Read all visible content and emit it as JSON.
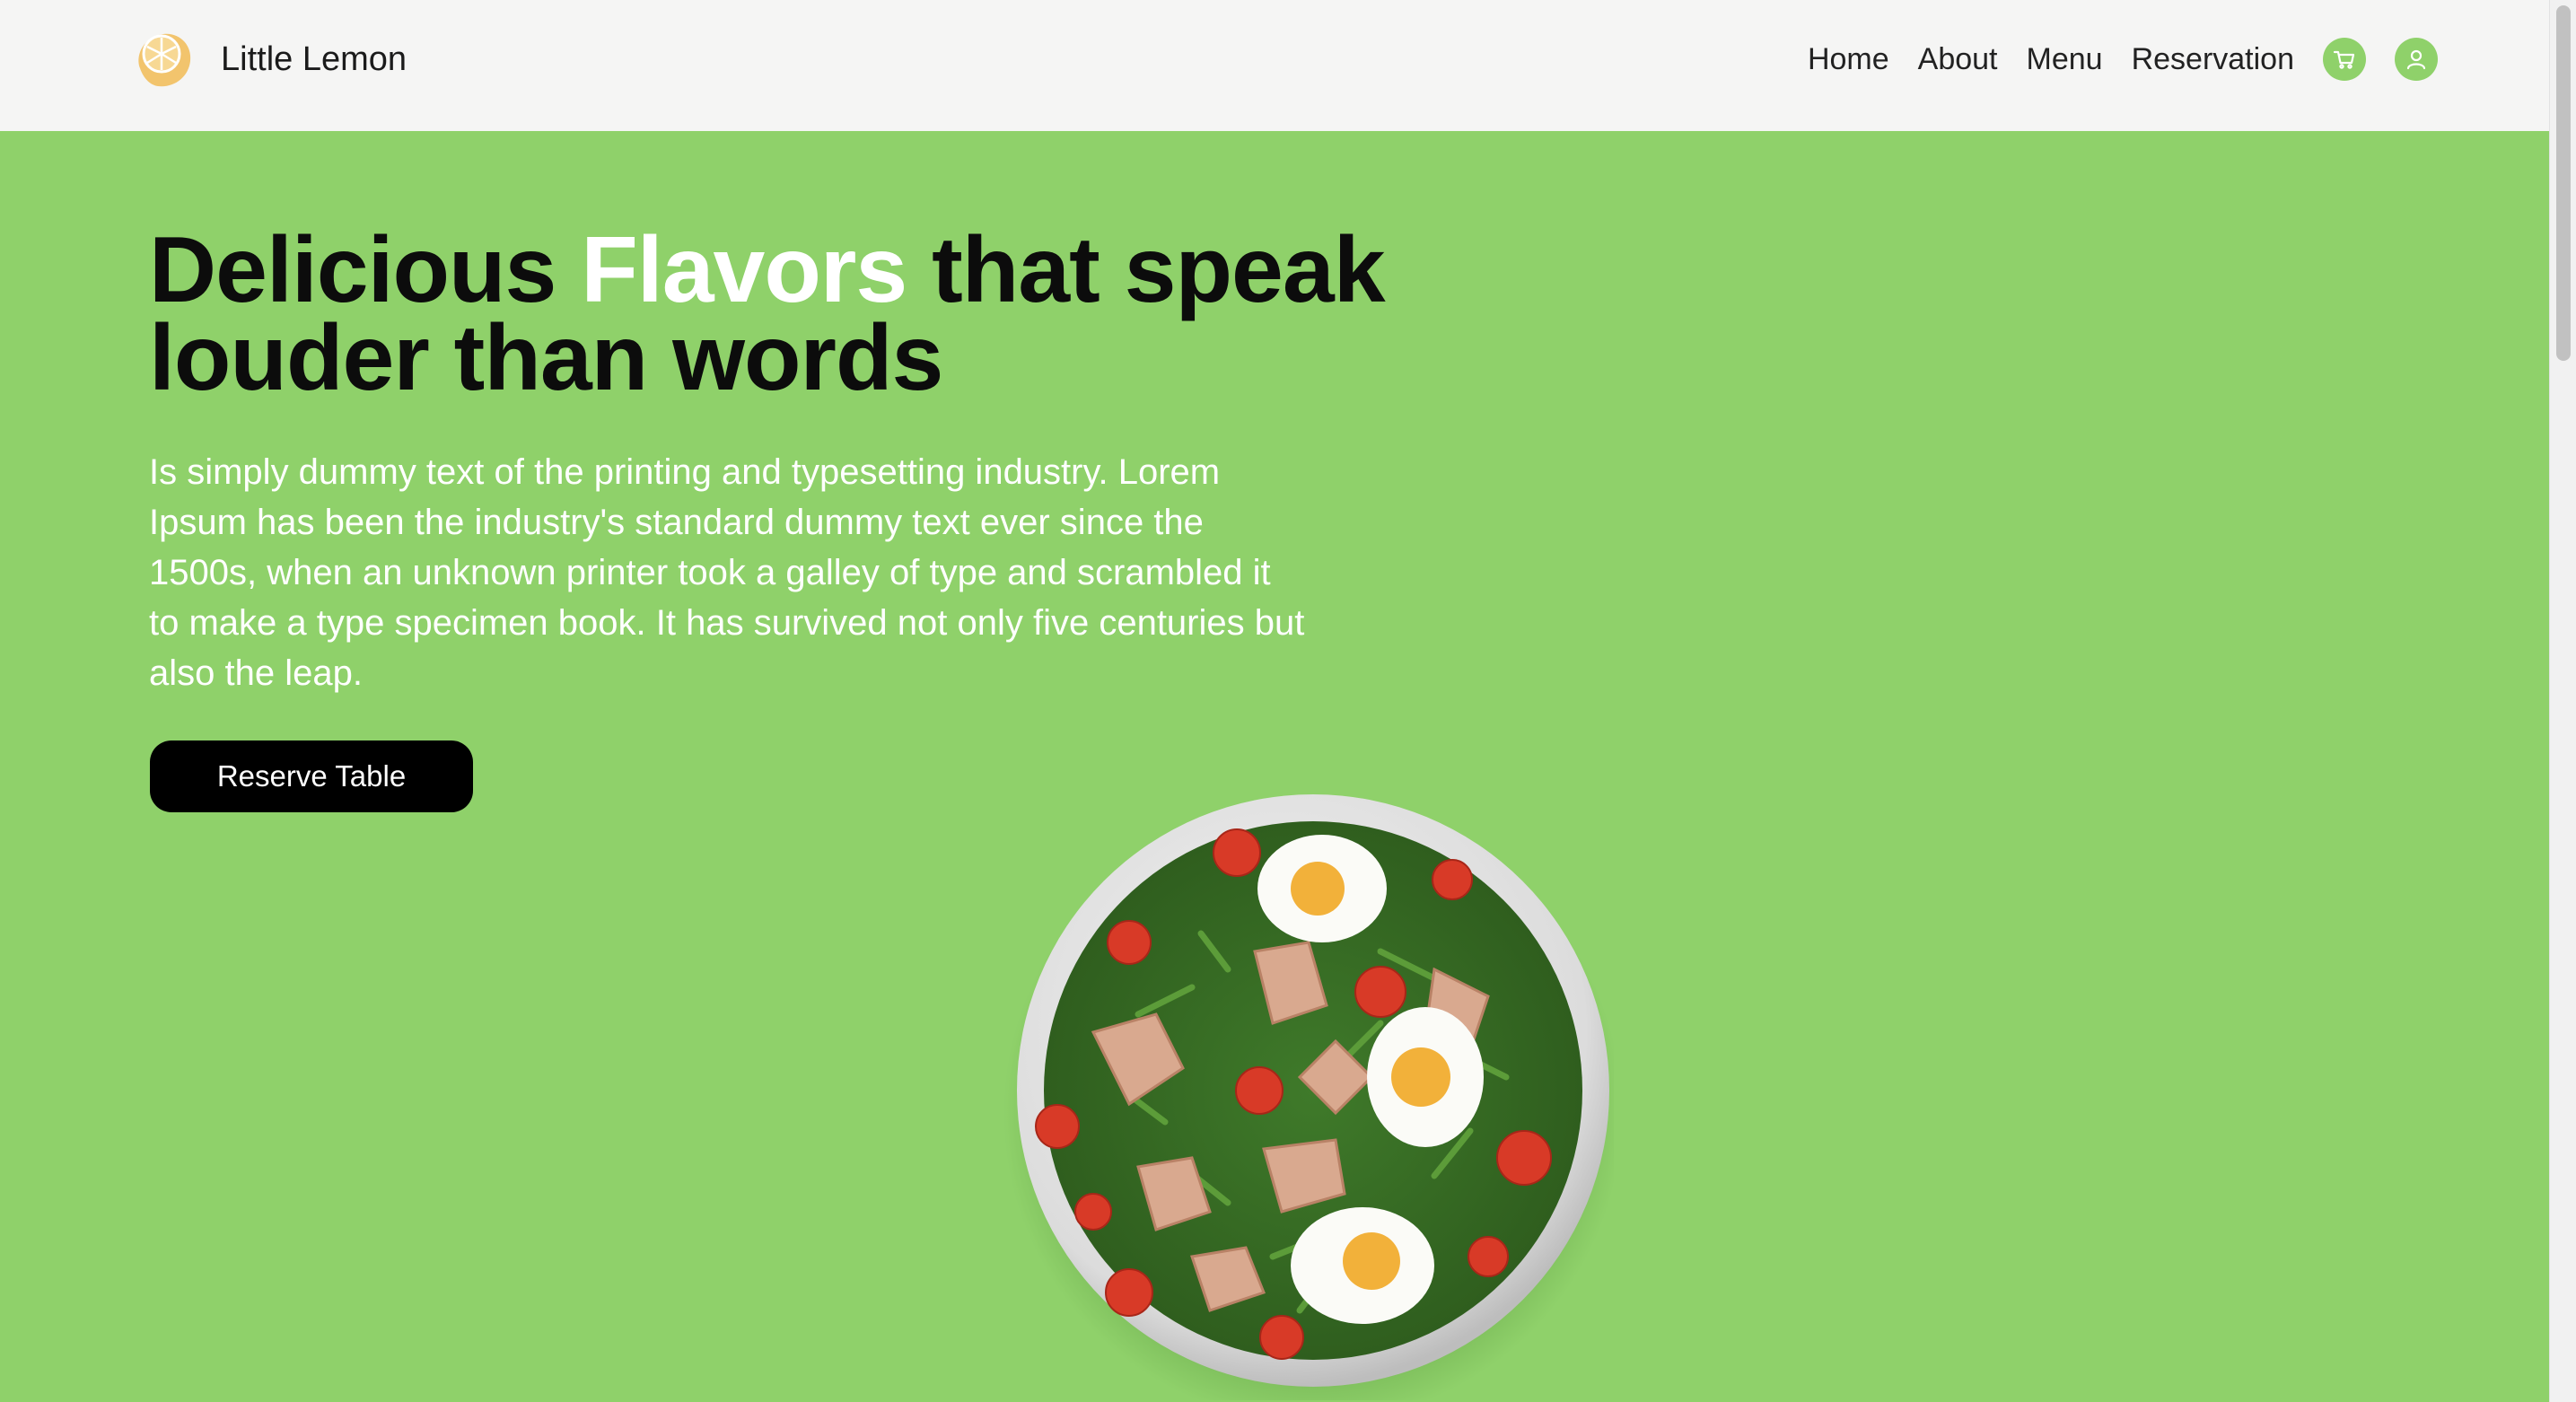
{
  "brand": {
    "name": "Little Lemon",
    "logo_icon": "lemon-icon",
    "logo_color": "#f2c46d"
  },
  "nav": {
    "items": [
      {
        "label": "Home"
      },
      {
        "label": "About"
      },
      {
        "label": "Menu"
      },
      {
        "label": "Reservation"
      }
    ],
    "cart_icon": "cart-icon",
    "user_icon": "user-icon"
  },
  "hero": {
    "title_part1": "Delicious ",
    "title_accent": "Flavors",
    "title_part2": " that speak louder than words",
    "description": "Is simply dummy text of the printing and typesetting industry. Lorem Ipsum has been the industry's standard dummy text ever since the 1500s, when an unknown printer took a galley of type and scrambled it to make a type specimen book. It has survived not only five centuries but also the leap.",
    "cta_label": "Reserve Table",
    "image": "salad-bowl"
  },
  "colors": {
    "accent_green": "#8fd16a",
    "header_bg": "#f5f5f4",
    "button_bg": "#000000",
    "text_white": "#ffffff"
  }
}
